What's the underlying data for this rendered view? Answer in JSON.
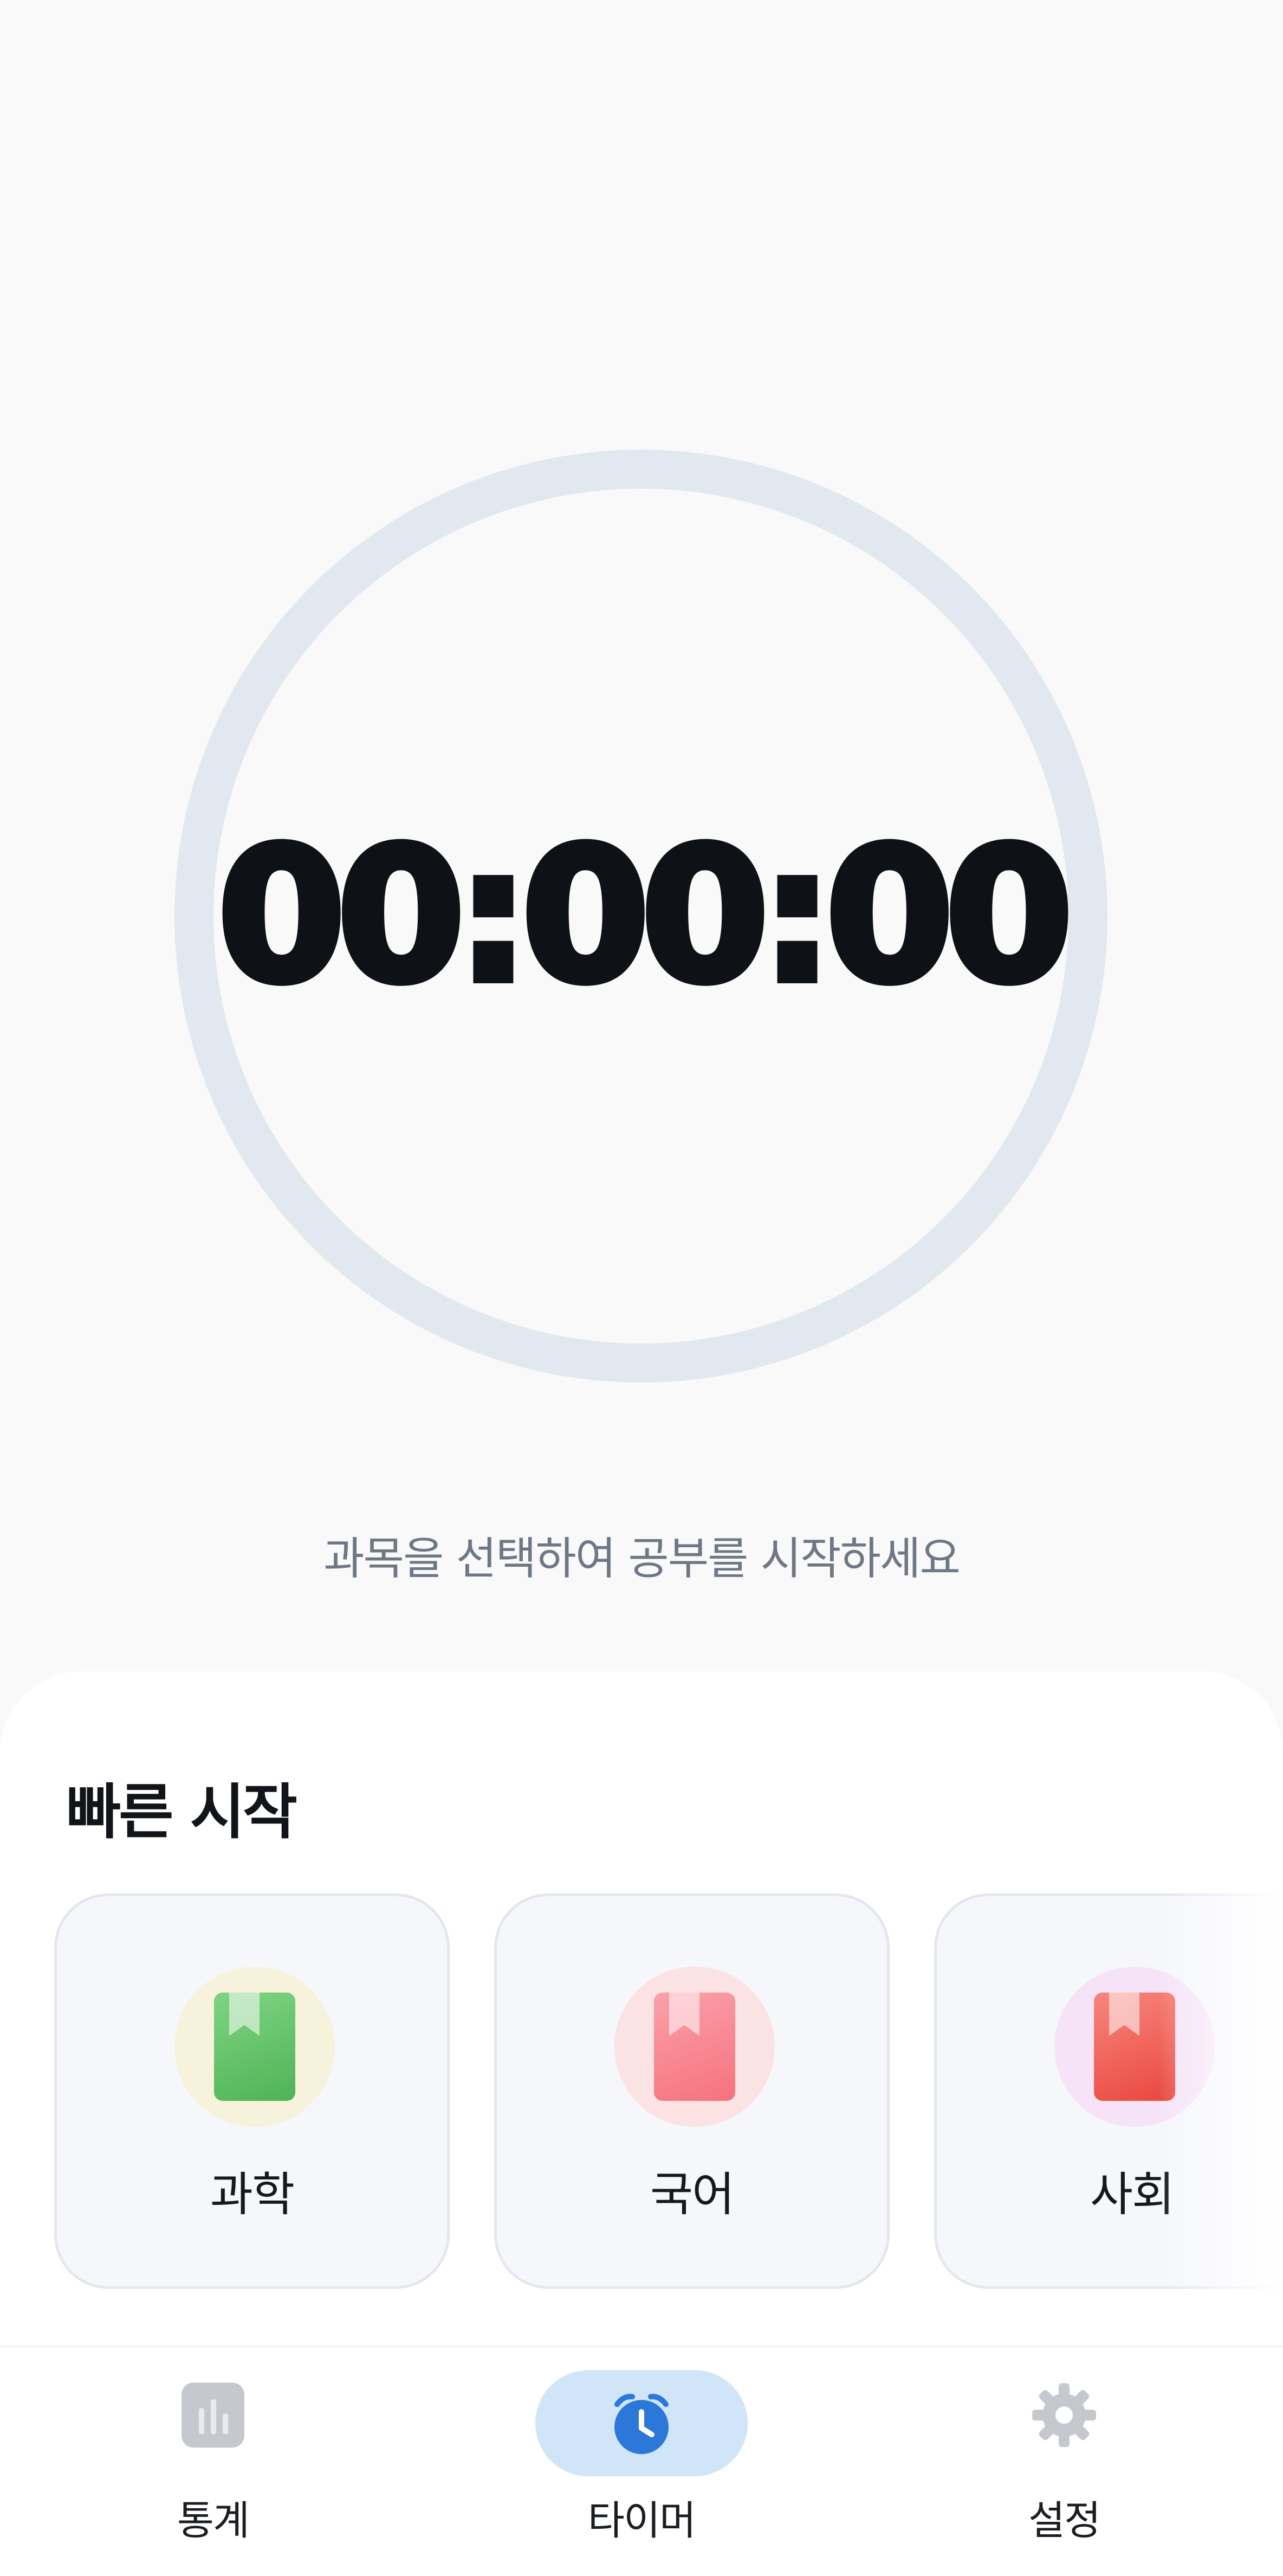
{
  "timer": {
    "display": "00:00:00",
    "hint": "과목을 선택하여 공부를 시작하세요"
  },
  "quick_start": {
    "title": "빠른 시작",
    "subjects": [
      {
        "label": "과학",
        "icon": "book-icon",
        "circle_color": "#f7f2dc",
        "book_color": "#5dbd63"
      },
      {
        "label": "국어",
        "icon": "book-icon",
        "circle_color": "#fbe3e3",
        "book_color": "#f7808e"
      },
      {
        "label": "사회",
        "icon": "book-icon",
        "circle_color": "#f6e3f7",
        "book_color": "#f0584e"
      }
    ]
  },
  "nav": {
    "items": [
      {
        "label": "통계",
        "icon": "bar-chart-icon",
        "active": false
      },
      {
        "label": "타이머",
        "icon": "alarm-clock-icon",
        "active": true
      },
      {
        "label": "설정",
        "icon": "gear-icon",
        "active": false
      }
    ],
    "active_color": "#2b78d9",
    "active_bg": "#d1e5f8"
  }
}
